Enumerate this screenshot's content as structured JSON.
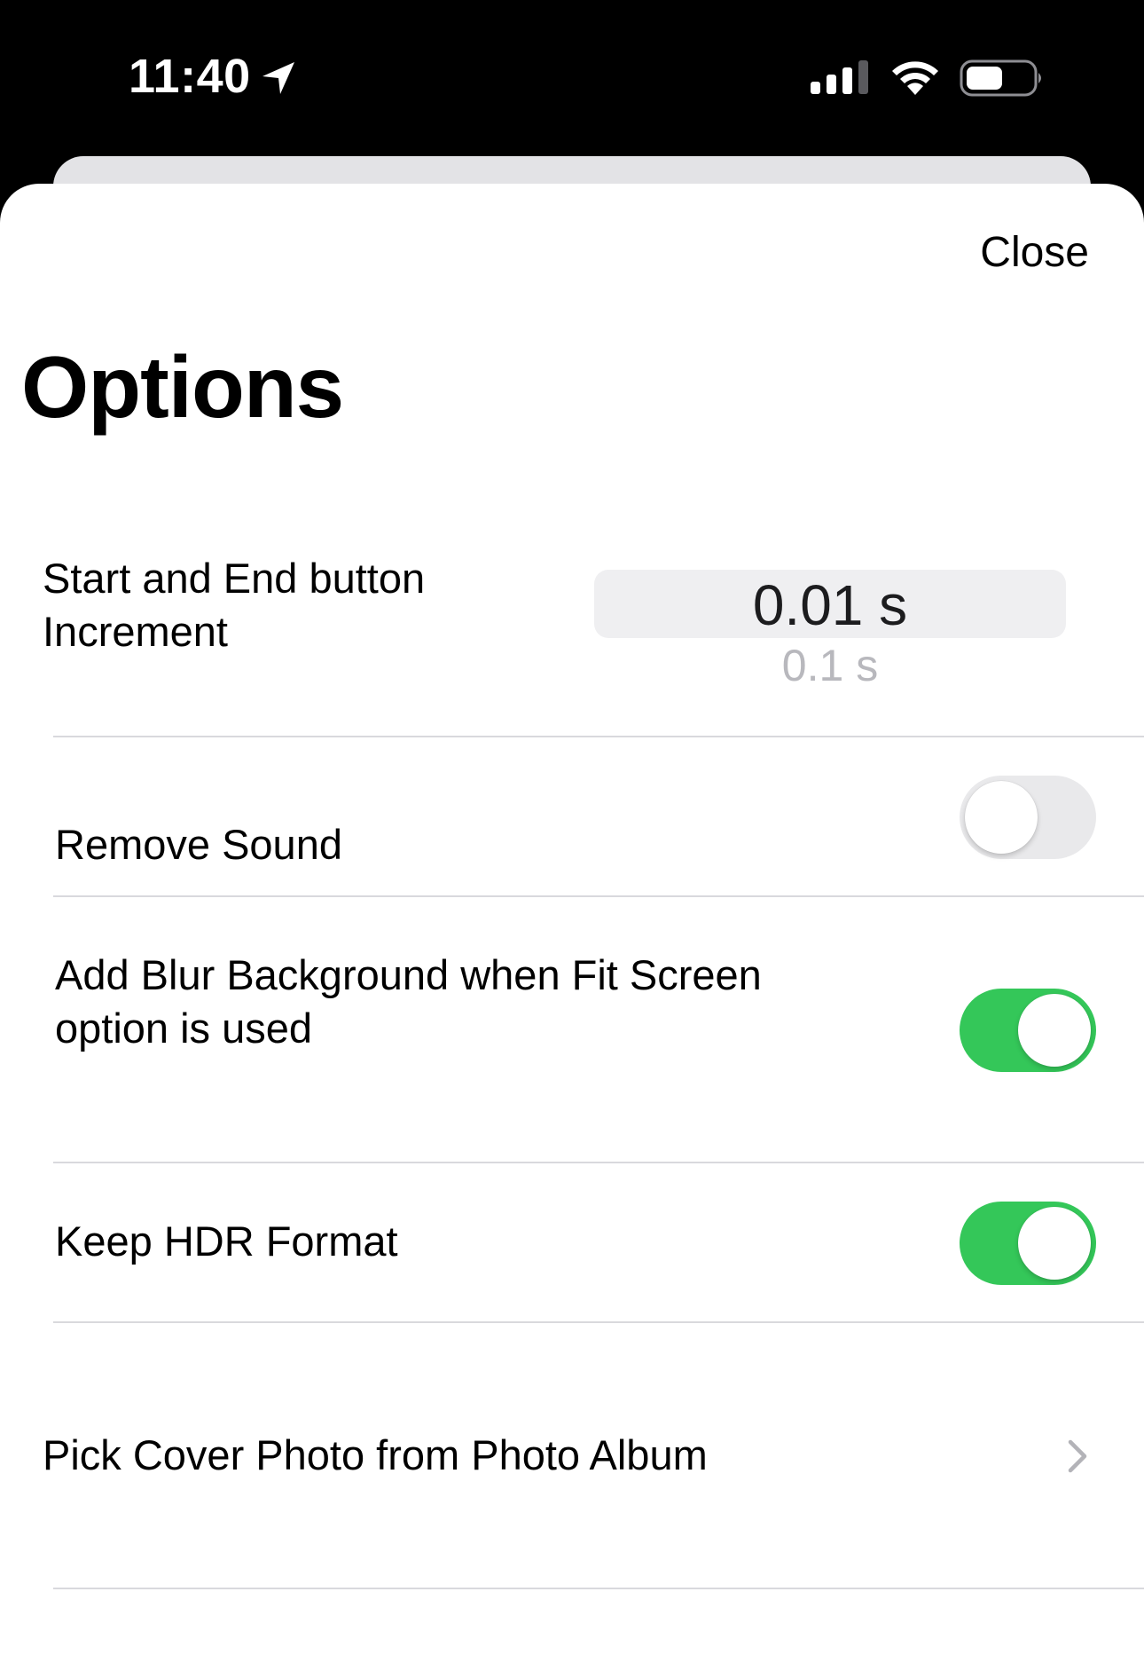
{
  "status_bar": {
    "time": "11:40",
    "icons": [
      "location-arrow-icon",
      "cellular-signal-icon",
      "wifi-icon",
      "battery-icon"
    ]
  },
  "header": {
    "close_label": "Close",
    "title": "Options"
  },
  "settings": {
    "increment": {
      "label_line1": "Start and End button",
      "label_line2": "Increment",
      "selected_value": "0.01 s",
      "next_value": "0.1 s"
    },
    "remove_sound": {
      "label": "Remove Sound",
      "enabled": false
    },
    "blur_background": {
      "label_line1": "Add Blur Background when Fit Screen",
      "label_line2": "option is used",
      "enabled": true
    },
    "keep_hdr": {
      "label": "Keep HDR Format",
      "enabled": true
    },
    "cover_photo": {
      "label": "Pick Cover Photo from Photo Album"
    }
  },
  "colors": {
    "toggle_on": "#34c759",
    "toggle_off": "#e9e9eb",
    "divider": "#d9d9dd"
  }
}
